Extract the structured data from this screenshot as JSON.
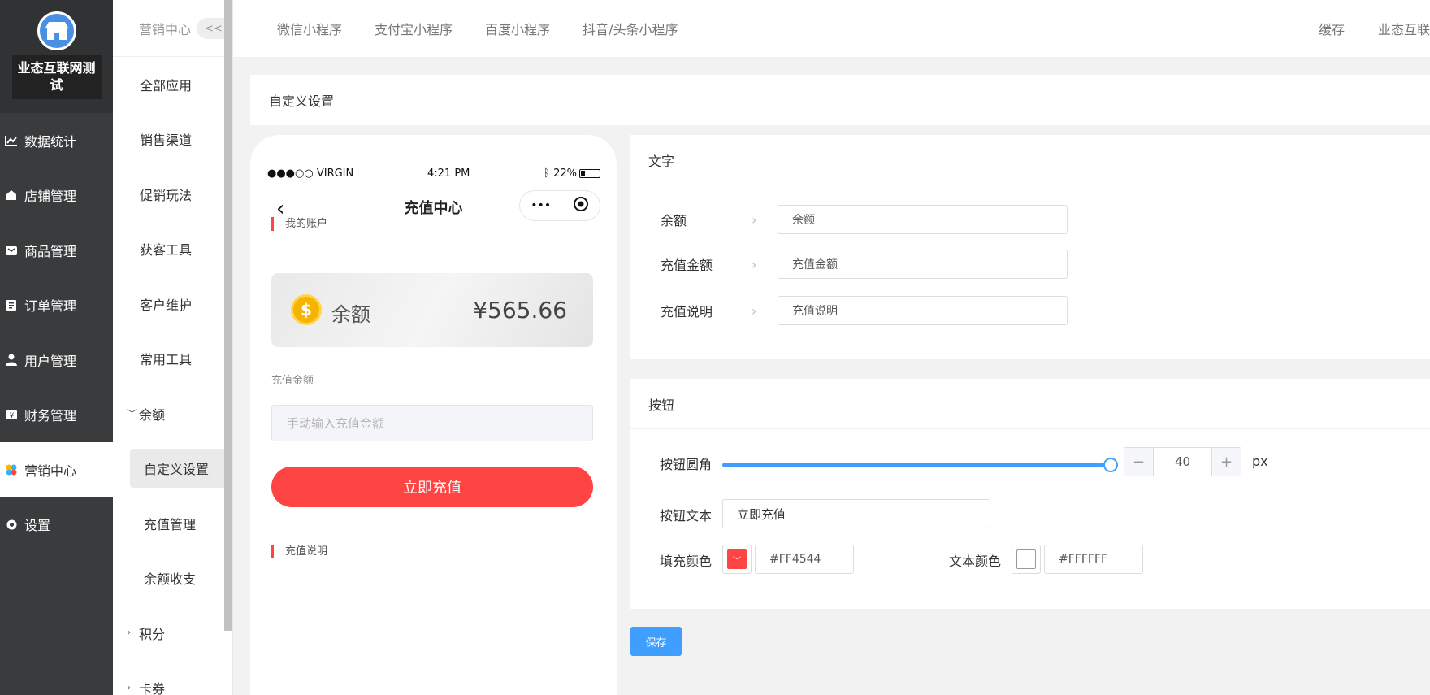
{
  "shop": {
    "name": "业态互联网测试",
    "logo_icon": "store-icon"
  },
  "sidebar": {
    "items": [
      {
        "label": "数据统计",
        "icon": "chart-line-icon"
      },
      {
        "label": "店铺管理",
        "icon": "shop-icon"
      },
      {
        "label": "商品管理",
        "icon": "bag-icon"
      },
      {
        "label": "订单管理",
        "icon": "order-icon"
      },
      {
        "label": "用户管理",
        "icon": "user-icon"
      },
      {
        "label": "财务管理",
        "icon": "finance-icon"
      },
      {
        "label": "营销中心",
        "icon": "marketing-icon",
        "active": true
      },
      {
        "label": "设置",
        "icon": "gear-icon"
      }
    ]
  },
  "submenu": {
    "header": "营销中心",
    "collapse_label": "<<",
    "items": [
      {
        "label": "全部应用"
      },
      {
        "label": "销售渠道"
      },
      {
        "label": "促销玩法"
      },
      {
        "label": "获客工具"
      },
      {
        "label": "客户维护"
      },
      {
        "label": "常用工具"
      }
    ],
    "balance_group": {
      "label": "余额",
      "expanded": true
    },
    "balance_children": [
      {
        "label": "自定义设置",
        "active": true
      },
      {
        "label": "充值管理"
      },
      {
        "label": "余额收支"
      }
    ],
    "collapsed_groups": [
      {
        "label": "积分"
      },
      {
        "label": "卡券"
      }
    ]
  },
  "topbar": {
    "tabs": [
      "微信小程序",
      "支付宝小程序",
      "百度小程序",
      "抖音/头条小程序"
    ],
    "cache": "缓存",
    "user": "业态互联"
  },
  "page": {
    "title": "自定义设置"
  },
  "phone": {
    "status": {
      "carrier": "●●●○○ VIRGIN",
      "time": "4:21 PM",
      "battery": "22%"
    },
    "title": "充值中心",
    "capsule_more": "•••",
    "my_account": "我的账户",
    "balance_label": "余额",
    "balance_value": "¥565.66",
    "amount_label": "充值金额",
    "amount_placeholder": "手动输入充值金额",
    "button_text": "立即充值",
    "desc_label": "充值说明"
  },
  "text_panel": {
    "title": "文字",
    "rows": [
      {
        "label": "余额",
        "value": "余额"
      },
      {
        "label": "充值金额",
        "value": "充值金额"
      },
      {
        "label": "充值说明",
        "value": "充值说明"
      }
    ]
  },
  "button_panel": {
    "title": "按钮",
    "radius_label": "按钮圆角",
    "radius_value": "40",
    "radius_unit": "px",
    "text_label": "按钮文本",
    "text_value": "立即充值",
    "fill_label": "填充颜色",
    "fill_color": "#FF4544",
    "text_color_label": "文本颜色",
    "text_color": "#FFFFFF"
  },
  "save_label": "保存",
  "colors": {
    "accent": "#409EFF",
    "brand_red": "#FF4544",
    "sidebar_bg": "#3A3B3C"
  }
}
